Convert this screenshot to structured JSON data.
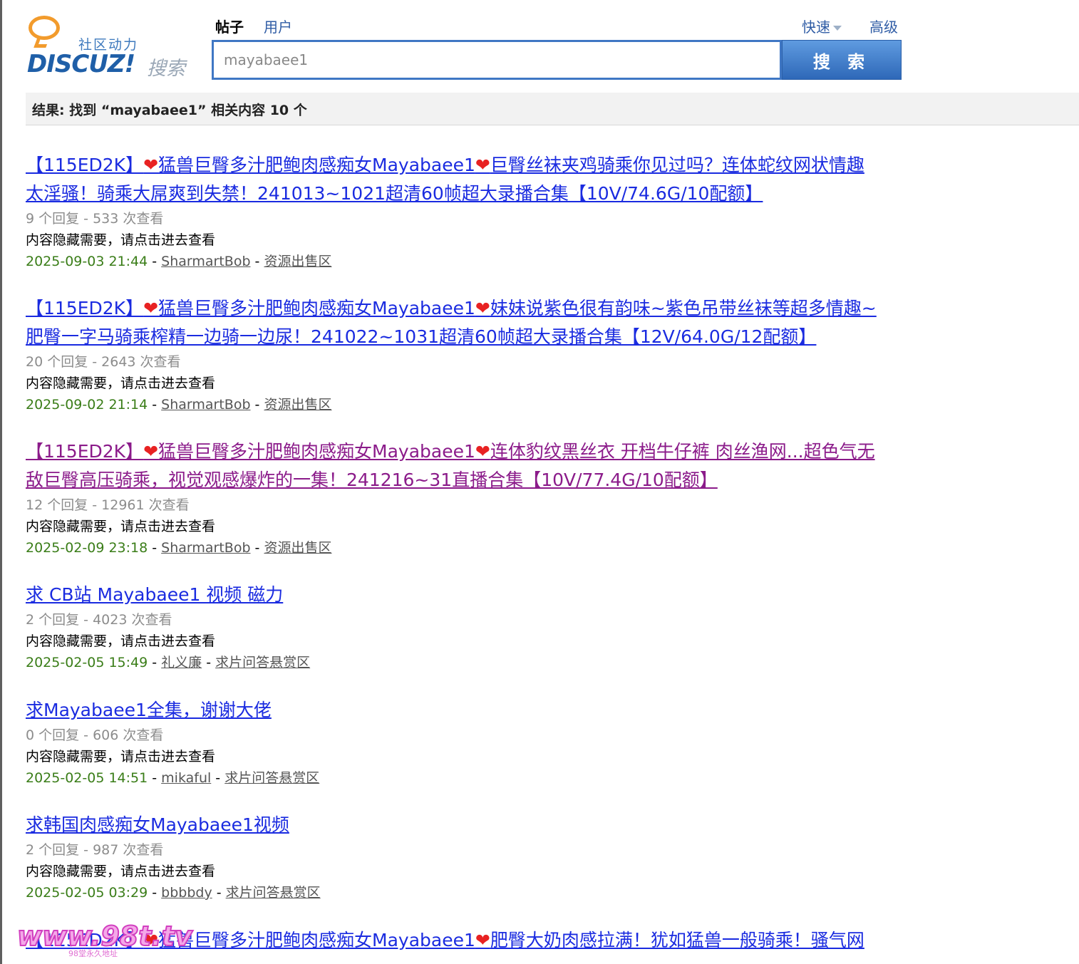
{
  "logo": {
    "subtitle": "社区动力",
    "brand": "DISCUZ!",
    "search_word": "搜索"
  },
  "tabs": {
    "active": "帖子",
    "user": "用户"
  },
  "top_links": {
    "fast": "快速",
    "advanced": "高级"
  },
  "search": {
    "value": "mayabaee1",
    "button": "搜 索"
  },
  "result_summary": "结果: 找到 “mayabaee1” 相关内容 10 个",
  "results": [
    {
      "title_a": "【115ED2K】",
      "title_b": "猛兽巨臀多汁肥鲍肉感痴女Mayabaee1",
      "title_c": "巨臀丝袜夹鸡骑乘你见过吗？连体蛇纹网状情趣",
      "title_d": "太淫骚！骑乘大屌爽到失禁！241013~1021超清60帧超大录播合集【10V/74.6G/10配额】",
      "stats": "9 个回复 - 533 次查看",
      "summary": "内容隐藏需要，请点击进去查看",
      "date": "2025-09-03 21:44",
      "author": "SharmartBob",
      "forum": "资源出售区"
    },
    {
      "title_a": "【115ED2K】",
      "title_b": "猛兽巨臀多汁肥鲍肉感痴女Mayabaee1",
      "title_c": "妹妹说紫色很有韵味~紫色吊带丝袜等超多情趣~",
      "title_d": "肥臀一字马骑乘榨精一边骑一边尿！241022~1031超清60帧超大录播合集【12V/64.0G/12配额】",
      "stats": "20 个回复 - 2643 次查看",
      "summary": "内容隐藏需要，请点击进去查看",
      "date": "2025-09-02 21:14",
      "author": "SharmartBob",
      "forum": "资源出售区"
    },
    {
      "title_a": "【115ED2K】",
      "title_b": "猛兽巨臀多汁肥鲍肉感痴女Mayabaee1",
      "title_c": "连体豹纹黑丝衣 开档牛仔裤 肉丝渔网...超色气无",
      "title_d": "敌巨臀高压骑乘，视觉观感爆炸的一集！241216~31直播合集【10V/77.4G/10配额】",
      "stats": "12 个回复 - 12961 次查看",
      "summary": "内容隐藏需要，请点击进去查看",
      "date": "2025-02-09 23:18",
      "author": "SharmartBob",
      "forum": "资源出售区"
    },
    {
      "title": "求 CB站 Mayabaee1 视频 磁力",
      "stats": "2 个回复 - 4023 次查看",
      "summary": "内容隐藏需要，请点击进去查看",
      "date": "2025-02-05 15:49",
      "author": "礼义廉",
      "forum": "求片问答悬赏区"
    },
    {
      "title": "求Mayabaee1全集，谢谢大佬",
      "stats": "0 个回复 - 606 次查看",
      "summary": "内容隐藏需要，请点击进去查看",
      "date": "2025-02-05 14:51",
      "author": "mikaful",
      "forum": "求片问答悬赏区"
    },
    {
      "title": "求韩国肉感痴女Mayabaee1视频",
      "stats": "2 个回复 - 987 次查看",
      "summary": "内容隐藏需要，请点击进去查看",
      "date": "2025-02-05 03:29",
      "author": "bbbbdy",
      "forum": "求片问答悬赏区"
    },
    {
      "title_a": "【115ED2K】",
      "title_b": "猛兽巨臀多汁肥鲍肉感痴女Mayabaee1",
      "title_c": "肥臀大奶肉感拉满！犹如猛兽一般骑乘！骚气网"
    }
  ],
  "separator": " - ",
  "heart_glyph": "❤",
  "watermark": {
    "text": "www.98t.tv",
    "sub": "98堂永久地址"
  }
}
